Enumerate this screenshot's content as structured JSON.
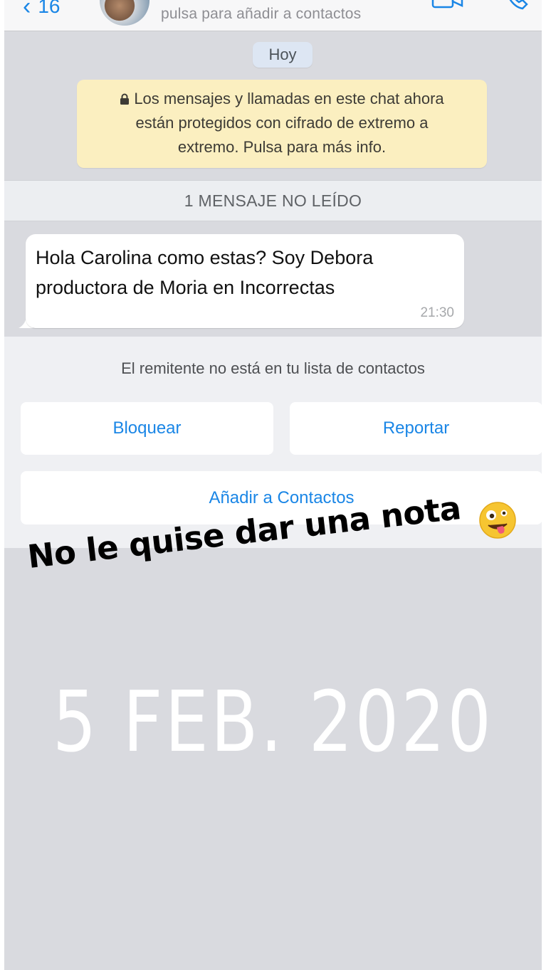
{
  "header": {
    "back_count": "16",
    "subtitle": "pulsa para añadir a contactos",
    "video_icon": "video-camera-icon",
    "call_icon": "phone-icon"
  },
  "chat": {
    "date_pill": "Hoy",
    "encryption_notice": {
      "line1": "Los mensajes y llamadas en este chat ahora",
      "line2": "están protegidos con cifrado de extremo a",
      "line3": "extremo. Pulsa para más info."
    },
    "unread_label": "1 MENSAJE NO LEÍDO",
    "message": {
      "line1": "Hola Carolina como estas? Soy Debora",
      "line2": "productora de Moria en Incorrectas",
      "time": "21:30"
    }
  },
  "sender_panel": {
    "notice": "El remitente no está en tu lista de contactos",
    "block_label": "Bloquear",
    "report_label": "Reportar",
    "add_label": "Añadir a Contactos"
  },
  "overlay": {
    "caption": "No le quise dar una nota",
    "emoji_icon": "zany-face-emoji",
    "date": "5 FEB. 2020"
  },
  "colors": {
    "accent": "#1a86e6",
    "notice_bg": "#fbefc0",
    "chat_bg": "#d9dadf"
  }
}
